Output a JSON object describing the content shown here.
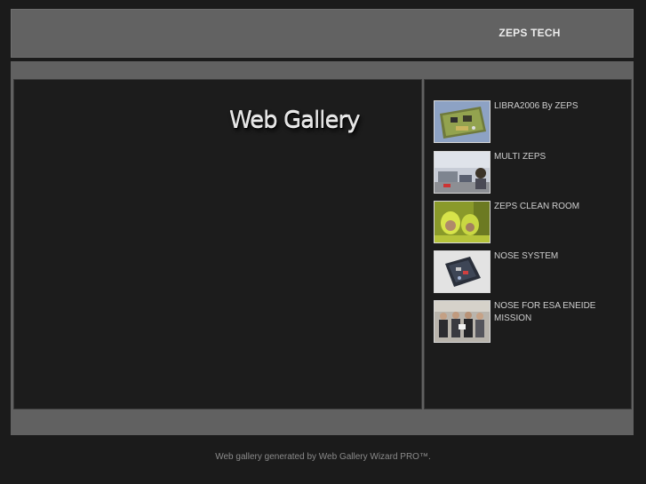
{
  "header": {
    "title": "ZEPS TECH"
  },
  "viewer": {
    "logo_text": "Web Gallery"
  },
  "gallery": {
    "items": [
      {
        "label": "LIBRA2006 By ZEPS",
        "thumb_icon": "circuit-board-photo"
      },
      {
        "label": "MULTI ZEPS",
        "thumb_icon": "lab-photo"
      },
      {
        "label": "ZEPS CLEAN ROOM",
        "thumb_icon": "clean-room-photo"
      },
      {
        "label": "NOSE SYSTEM",
        "thumb_icon": "device-photo"
      },
      {
        "label": "NOSE FOR ESA ENEIDE MISSION",
        "thumb_icon": "group-photo"
      }
    ]
  },
  "footer": {
    "text": "Web gallery generated by Web Gallery Wizard PRO™."
  }
}
